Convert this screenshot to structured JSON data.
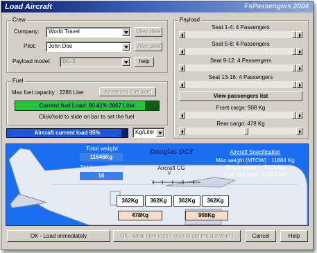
{
  "window": {
    "title": "Load Aircraft",
    "brand": "FsPassengers 2004"
  },
  "crew": {
    "group_label": "Crew",
    "company_label": "Company:",
    "company_value": "World Travel",
    "pilot_label": "Pilot:",
    "pilot_value": "John Doe",
    "payload_model_label": "Payload model:",
    "payload_model_value": "DC-3",
    "view_data_label": "View data",
    "help_label": "help"
  },
  "fuel": {
    "group_label": "Fuel",
    "max_capacity_text": "Max fuel capacity : 2286 Liter",
    "advanced_button": "Advanced fuel load",
    "current_load_text": "Current fuel Load: 90.41%  2067 Liter",
    "current_load_fraction": 0.9041,
    "hint": "Click/hold to slide on bar to set the fuel"
  },
  "load_bar": {
    "text": "Aircraft current load 95%",
    "fraction": 0.95,
    "unit_value": "Kg/Liter"
  },
  "payload": {
    "group_label": "Payload",
    "seats": [
      {
        "label": "Seat 1-4: 4 Passengers",
        "level": 1.0
      },
      {
        "label": "Seat 5-8: 4 Passengers",
        "level": 1.0
      },
      {
        "label": "Seat 9-12: 4 Passengers",
        "level": 1.0
      },
      {
        "label": "Seat 13-16: 4 Passengers",
        "level": 1.0
      }
    ],
    "view_list_button": "View passengers list",
    "front_cargo": {
      "label": "Front cargo: 908 Kg",
      "level": 1.0
    },
    "rear_cargo": {
      "label": "Rear cargo: 478 Kg",
      "level": 0.55
    }
  },
  "aircraft": {
    "name": "Douglas DC3",
    "total_weight_label": "Total weight",
    "total_weight_value": "11646Kg",
    "total_passengers_label": "Total passengers",
    "total_passengers_value": "16",
    "cg_label": "Aircraft CG",
    "cg_marker": "V",
    "spec_title": "Aircraft Specification",
    "spec_lines": [
      "Max weight (MTOW) : 11884 Kg",
      "Empty weight : 7323 Kg",
      "Max fuel load : 2286 Liter"
    ],
    "seat_loads": [
      "362Kg",
      "362Kg",
      "362Kg",
      "362Kg"
    ],
    "front_cargo_load": "478Kg",
    "rear_cargo_load": "908Kg",
    "colors": {
      "panel": "#1a6ff0",
      "fuel_bar": "#22c43a",
      "load_bar": "#1d54d8"
    }
  },
  "footer": {
    "ok_button": "OK - Load immediately",
    "realtime_button": "OK - Real time load   ( click to set the duration )",
    "cancel_button": "Cancel",
    "help_button": "Help"
  }
}
